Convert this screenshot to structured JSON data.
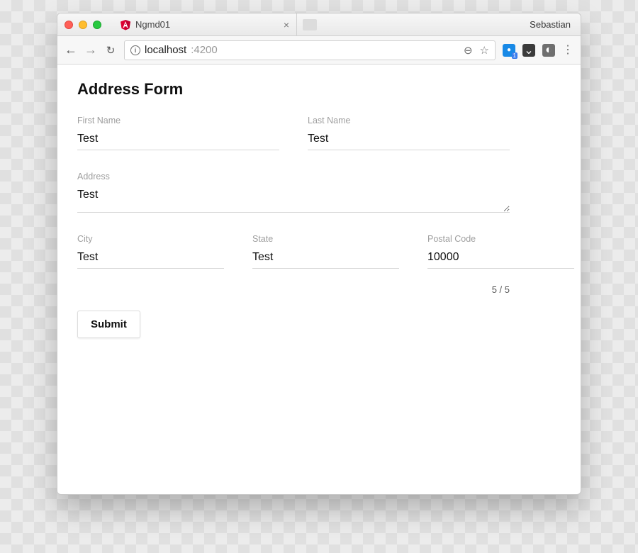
{
  "window": {
    "profile_name": "Sebastian"
  },
  "tab": {
    "title": "Ngmd01",
    "close_glyph": "×"
  },
  "toolbar": {
    "back_glyph": "←",
    "forward_glyph": "→",
    "reload_glyph": "↻",
    "info_glyph": "i",
    "url_host": "localhost",
    "url_port": ":4200",
    "zoom_out_glyph": "⊖",
    "star_glyph": "☆",
    "ext_badge": "1",
    "pocket_glyph": "⌄",
    "bulb_glyph": "◐",
    "menu_glyph": "⋮"
  },
  "page": {
    "title": "Address Form",
    "first_name_label": "First Name",
    "first_name_value": "Test",
    "last_name_label": "Last Name",
    "last_name_value": "Test",
    "address_label": "Address",
    "address_value": "Test",
    "city_label": "City",
    "city_value": "Test",
    "state_label": "State",
    "state_value": "Test",
    "postal_label": "Postal Code",
    "postal_value": "10000",
    "counter": "5 / 5",
    "submit_label": "Submit"
  }
}
